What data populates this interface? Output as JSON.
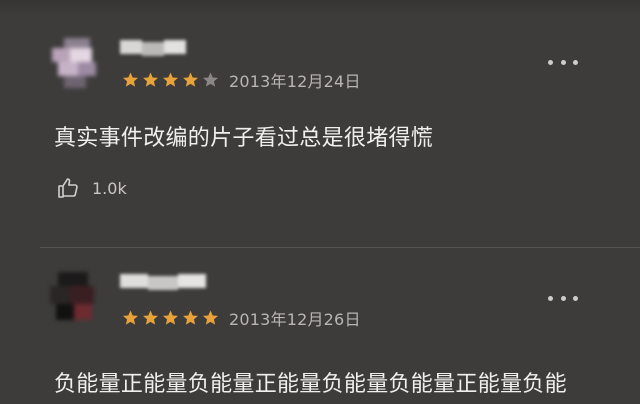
{
  "colors": {
    "background": "#3d3c3b",
    "star_filled": "#e8a23a",
    "star_empty": "#8a8784",
    "text_primary": "#f1efec",
    "text_secondary": "#b9b6b1"
  },
  "reviews": [
    {
      "rating": 4,
      "max_rating": 5,
      "date": "2013年12月24日",
      "content": "真实事件改编的片子看过总是很堵得慌",
      "likes": "1.0k",
      "more_icon": "more-horizontal-icon",
      "like_icon": "thumbs-up-icon"
    },
    {
      "rating": 5,
      "max_rating": 5,
      "date": "2013年12月26日",
      "content": "负能量正能量负能量正能量负能量负能量正能量负能",
      "more_icon": "more-horizontal-icon"
    }
  ]
}
